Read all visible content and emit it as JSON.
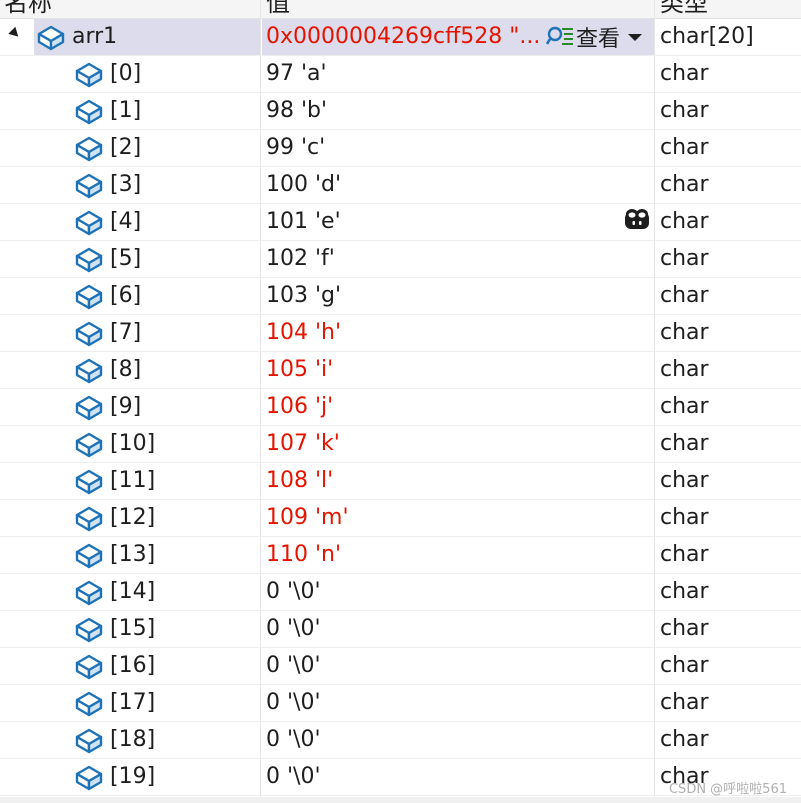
{
  "columns": {
    "name": "名称",
    "value": "值",
    "type": "类型"
  },
  "colors": {
    "changed": "#e51400",
    "icon": "#1e73b8",
    "selected_bg": "#dcdcec"
  },
  "parent": {
    "name": "arr1",
    "value": "0x0000004269cff528 \"...",
    "viewer_label": "查看",
    "type": "char[20]",
    "expanded": true
  },
  "items": [
    {
      "name": "[0]",
      "value": "97 'a'",
      "type": "char",
      "changed": false
    },
    {
      "name": "[1]",
      "value": "98 'b'",
      "type": "char",
      "changed": false
    },
    {
      "name": "[2]",
      "value": "99 'c'",
      "type": "char",
      "changed": false
    },
    {
      "name": "[3]",
      "value": "100 'd'",
      "type": "char",
      "changed": false
    },
    {
      "name": "[4]",
      "value": "101 'e'",
      "type": "char",
      "changed": false
    },
    {
      "name": "[5]",
      "value": "102 'f'",
      "type": "char",
      "changed": false
    },
    {
      "name": "[6]",
      "value": "103 'g'",
      "type": "char",
      "changed": false
    },
    {
      "name": "[7]",
      "value": "104 'h'",
      "type": "char",
      "changed": true
    },
    {
      "name": "[8]",
      "value": "105 'i'",
      "type": "char",
      "changed": true
    },
    {
      "name": "[9]",
      "value": "106 'j'",
      "type": "char",
      "changed": true
    },
    {
      "name": "[10]",
      "value": "107 'k'",
      "type": "char",
      "changed": true
    },
    {
      "name": "[11]",
      "value": "108 'l'",
      "type": "char",
      "changed": true
    },
    {
      "name": "[12]",
      "value": "109 'm'",
      "type": "char",
      "changed": true
    },
    {
      "name": "[13]",
      "value": "110 'n'",
      "type": "char",
      "changed": true
    },
    {
      "name": "[14]",
      "value": "0 '\\0'",
      "type": "char",
      "changed": false
    },
    {
      "name": "[15]",
      "value": "0 '\\0'",
      "type": "char",
      "changed": false
    },
    {
      "name": "[16]",
      "value": "0 '\\0'",
      "type": "char",
      "changed": false
    },
    {
      "name": "[17]",
      "value": "0 '\\0'",
      "type": "char",
      "changed": false
    },
    {
      "name": "[18]",
      "value": "0 '\\0'",
      "type": "char",
      "changed": false
    },
    {
      "name": "[19]",
      "value": "0 '\\0'",
      "type": "char",
      "changed": false
    }
  ],
  "watermark": "CSDN @呼啦啦561"
}
